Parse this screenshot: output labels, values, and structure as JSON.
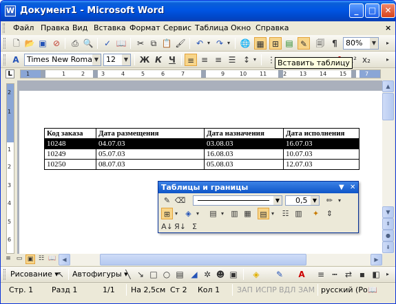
{
  "window": {
    "title": "Документ1 - Microsoft Word",
    "app_icon": "W",
    "minimize": "_",
    "maximize": "□",
    "close": "✕"
  },
  "menu": {
    "items": [
      "Файл",
      "Правка",
      "Вид",
      "Вставка",
      "Формат",
      "Сервис",
      "Таблица",
      "Окно",
      "Справка"
    ],
    "underline": [
      "Ф",
      "П",
      "В",
      "а",
      "о",
      "С",
      "Т",
      "О",
      "С"
    ],
    "close_doc": "×"
  },
  "toolbar_standard": {
    "zoom": "80%",
    "icons": [
      "new-icon",
      "open-icon",
      "save-icon",
      "permission-icon",
      "print-icon",
      "print-preview-icon",
      "spelling-icon",
      "research-icon",
      "cut-icon",
      "copy-icon",
      "paste-icon",
      "format-painter-icon",
      "undo-icon",
      "redo-icon",
      "hyperlink-icon",
      "tables-borders-icon",
      "insert-table-icon",
      "insert-excel-icon",
      "columns-icon",
      "drawing-icon",
      "document-map-icon",
      "show-formatting-icon"
    ]
  },
  "toolbar_formatting": {
    "style_pane_icon": "styles-icon",
    "font": "Times New Roman",
    "size": "12",
    "bold": "Ж",
    "italic": "К",
    "underline": "Ч",
    "superscript": "x²",
    "subscript": "x₂"
  },
  "tooltip": "Вставить таблицу",
  "ruler": {
    "tab_selector": "L",
    "numbers": [
      "1",
      "1",
      "2",
      "3",
      "4",
      "5",
      "6",
      "7",
      "8",
      "9",
      "10",
      "11",
      "12",
      "13",
      "14",
      "15",
      "16",
      "7"
    ]
  },
  "vertical_ruler": {
    "numbers": [
      "2",
      "1",
      "1",
      "2",
      "3",
      "4",
      "5",
      "6",
      "7"
    ]
  },
  "table": {
    "headers": [
      "Код заказа",
      "Дата размещения",
      "Дата назначения",
      "Дата исполнения"
    ],
    "rows": [
      [
        "10248",
        "04.07.03",
        "03.08.03",
        "16.07.03"
      ],
      [
        "10249",
        "05.07.03",
        "16.08.03",
        "10.07.03"
      ],
      [
        "10250",
        "08.07.03",
        "05.08.03",
        "12.07.03"
      ]
    ],
    "selected_row": 0
  },
  "floating_toolbar": {
    "title": "Таблицы и границы",
    "line_weight": "0,5"
  },
  "drawing_toolbar": {
    "draw_label": "Рисование",
    "autoshapes_label": "Автофигуры"
  },
  "status": {
    "page": "Стр. 1",
    "section": "Разд 1",
    "pages": "1/1",
    "position": "На 2,5см",
    "line": "Ст 2",
    "column": "Кол 1",
    "rec": "ЗАП",
    "trk": "ИСПР",
    "ext": "ВДЛ",
    "ovr": "ЗАМ",
    "language": "русский (Ро"
  },
  "colors": {
    "titlebar": "#0055e3",
    "selection": "#000000",
    "highlight_button": "#f7d58a"
  }
}
